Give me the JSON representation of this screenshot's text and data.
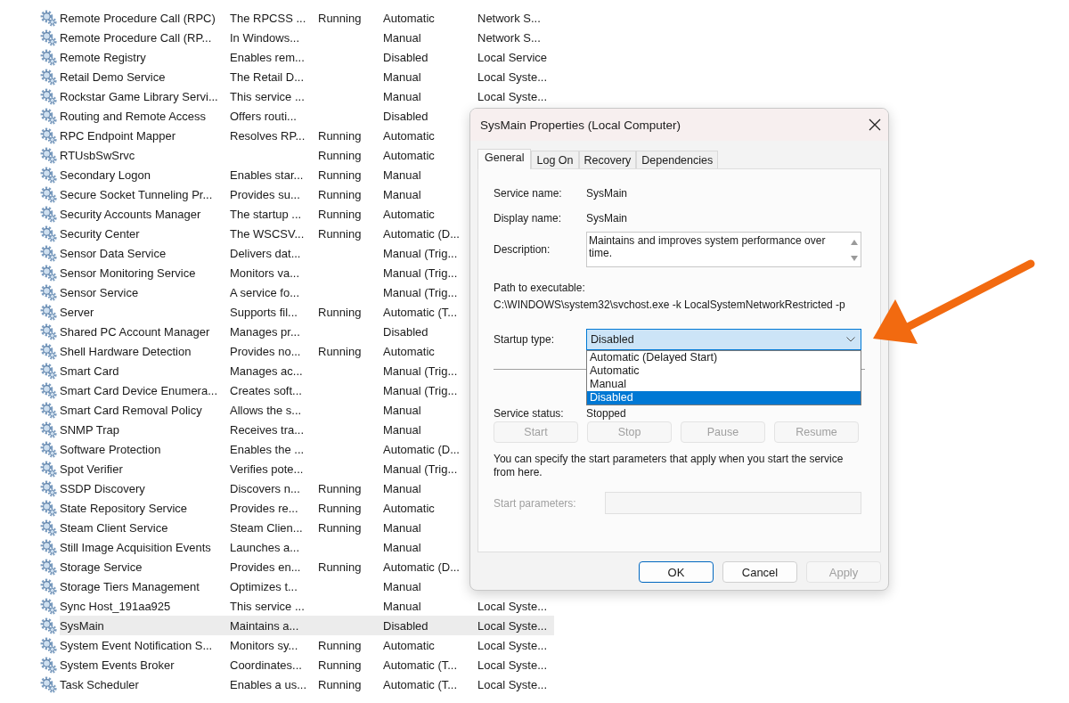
{
  "services": {
    "rows": [
      {
        "name": "Remote Procedure Call (RPC)",
        "description": "The RPCSS ...",
        "status": "Running",
        "startup_type": "Automatic",
        "log_on_as": "Network S...",
        "selected": false
      },
      {
        "name": "Remote Procedure Call (RP...",
        "description": "In Windows...",
        "startup_type": "Manual",
        "log_on_as": "Network S...",
        "selected": false
      },
      {
        "name": "Remote Registry",
        "description": "Enables rem...",
        "startup_type": "Disabled",
        "log_on_as": "Local Service",
        "selected": false
      },
      {
        "name": "Retail Demo Service",
        "description": "The Retail D...",
        "startup_type": "Manual",
        "log_on_as": "Local Syste...",
        "selected": false
      },
      {
        "name": "Rockstar Game Library Servi...",
        "description": "This service ...",
        "startup_type": "Manual",
        "log_on_as": "Local Syste...",
        "selected": false
      },
      {
        "name": "Routing and Remote Access",
        "description": "Offers routi...",
        "startup_type": "Disabled",
        "selected": false
      },
      {
        "name": "RPC Endpoint Mapper",
        "description": "Resolves RP...",
        "status": "Running",
        "startup_type": "Automatic",
        "selected": false
      },
      {
        "name": "RTUsbSwSrvc",
        "status": "Running",
        "startup_type": "Automatic",
        "selected": false
      },
      {
        "name": "Secondary Logon",
        "description": "Enables star...",
        "status": "Running",
        "startup_type": "Manual",
        "selected": false
      },
      {
        "name": "Secure Socket Tunneling Pr...",
        "description": "Provides su...",
        "status": "Running",
        "startup_type": "Manual",
        "selected": false
      },
      {
        "name": "Security Accounts Manager",
        "description": "The startup ...",
        "status": "Running",
        "startup_type": "Automatic",
        "selected": false
      },
      {
        "name": "Security Center",
        "description": "The WSCSV...",
        "status": "Running",
        "startup_type": "Automatic (D...",
        "selected": false
      },
      {
        "name": "Sensor Data Service",
        "description": "Delivers dat...",
        "startup_type": "Manual (Trig...",
        "selected": false
      },
      {
        "name": "Sensor Monitoring Service",
        "description": "Monitors va...",
        "startup_type": "Manual (Trig...",
        "selected": false
      },
      {
        "name": "Sensor Service",
        "description": "A service fo...",
        "startup_type": "Manual (Trig...",
        "selected": false
      },
      {
        "name": "Server",
        "description": "Supports fil...",
        "status": "Running",
        "startup_type": "Automatic (T...",
        "selected": false
      },
      {
        "name": "Shared PC Account Manager",
        "description": "Manages pr...",
        "startup_type": "Disabled",
        "selected": false
      },
      {
        "name": "Shell Hardware Detection",
        "description": "Provides no...",
        "status": "Running",
        "startup_type": "Automatic",
        "selected": false
      },
      {
        "name": "Smart Card",
        "description": "Manages ac...",
        "startup_type": "Manual (Trig...",
        "selected": false
      },
      {
        "name": "Smart Card Device Enumera...",
        "description": "Creates soft...",
        "startup_type": "Manual (Trig...",
        "selected": false
      },
      {
        "name": "Smart Card Removal Policy",
        "description": "Allows the s...",
        "startup_type": "Manual",
        "selected": false
      },
      {
        "name": "SNMP Trap",
        "description": "Receives tra...",
        "startup_type": "Manual",
        "selected": false
      },
      {
        "name": "Software Protection",
        "description": "Enables the ...",
        "startup_type": "Automatic (D...",
        "selected": false
      },
      {
        "name": "Spot Verifier",
        "description": "Verifies pote...",
        "startup_type": "Manual (Trig...",
        "selected": false
      },
      {
        "name": "SSDP Discovery",
        "description": "Discovers n...",
        "status": "Running",
        "startup_type": "Manual",
        "selected": false
      },
      {
        "name": "State Repository Service",
        "description": "Provides re...",
        "status": "Running",
        "startup_type": "Automatic",
        "selected": false
      },
      {
        "name": "Steam Client Service",
        "description": "Steam Clien...",
        "status": "Running",
        "startup_type": "Manual",
        "selected": false
      },
      {
        "name": "Still Image Acquisition Events",
        "description": "Launches a...",
        "startup_type": "Manual",
        "selected": false
      },
      {
        "name": "Storage Service",
        "description": "Provides en...",
        "status": "Running",
        "startup_type": "Automatic (D...",
        "selected": false
      },
      {
        "name": "Storage Tiers Management",
        "description": "Optimizes t...",
        "startup_type": "Manual",
        "selected": false
      },
      {
        "name": "Sync Host_191aa925",
        "description": "This service ...",
        "startup_type": "Manual",
        "log_on_as": "Local Syste...",
        "selected": false
      },
      {
        "name": "SysMain",
        "description": "Maintains a...",
        "startup_type": "Disabled",
        "log_on_as": "Local Syste...",
        "selected": true
      },
      {
        "name": "System Event Notification S...",
        "description": "Monitors sy...",
        "status": "Running",
        "startup_type": "Automatic",
        "log_on_as": "Local Syste...",
        "selected": false
      },
      {
        "name": "System Events Broker",
        "description": "Coordinates...",
        "status": "Running",
        "startup_type": "Automatic (T...",
        "log_on_as": "Local Syste...",
        "selected": false
      },
      {
        "name": "Task Scheduler",
        "description": "Enables a us...",
        "status": "Running",
        "startup_type": "Automatic (T...",
        "log_on_as": "Local Syste...",
        "selected": false
      }
    ]
  },
  "dialog": {
    "title": "SysMain Properties (Local Computer)",
    "tabs": [
      {
        "label": "General",
        "selected": true
      },
      {
        "label": "Log On",
        "selected": false
      },
      {
        "label": "Recovery",
        "selected": false
      },
      {
        "label": "Dependencies",
        "selected": false
      }
    ],
    "service_name": {
      "label": "Service name:",
      "value": "SysMain"
    },
    "display_name": {
      "label": "Display name:",
      "value": "SysMain"
    },
    "description": {
      "label": "Description:",
      "value": "Maintains and improves system performance over time."
    },
    "path": {
      "label": "Path to executable:",
      "value": "C:\\WINDOWS\\system32\\svchost.exe -k LocalSystemNetworkRestricted -p"
    },
    "startup_type": {
      "label": "Startup type:",
      "value": "Disabled",
      "expanded": true,
      "options": [
        {
          "label": "Automatic (Delayed Start)",
          "selected": false
        },
        {
          "label": "Automatic",
          "selected": false
        },
        {
          "label": "Manual",
          "selected": false
        },
        {
          "label": "Disabled",
          "selected": true
        }
      ]
    },
    "service_status": {
      "label": "Service status:",
      "value": "Stopped"
    },
    "service_buttons": [
      {
        "label": "Start",
        "disabled": true
      },
      {
        "label": "Stop",
        "disabled": true
      },
      {
        "label": "Pause",
        "disabled": true
      },
      {
        "label": "Resume",
        "disabled": true
      }
    ],
    "note": "You can specify the start parameters that apply when you start the service from here.",
    "start_parameters": {
      "label": "Start parameters:",
      "disabled": true
    },
    "buttons": [
      {
        "label": "OK",
        "default": true,
        "disabled": false
      },
      {
        "label": "Cancel",
        "default": false,
        "disabled": false
      },
      {
        "label": "Apply",
        "default": false,
        "disabled": true
      }
    ]
  }
}
